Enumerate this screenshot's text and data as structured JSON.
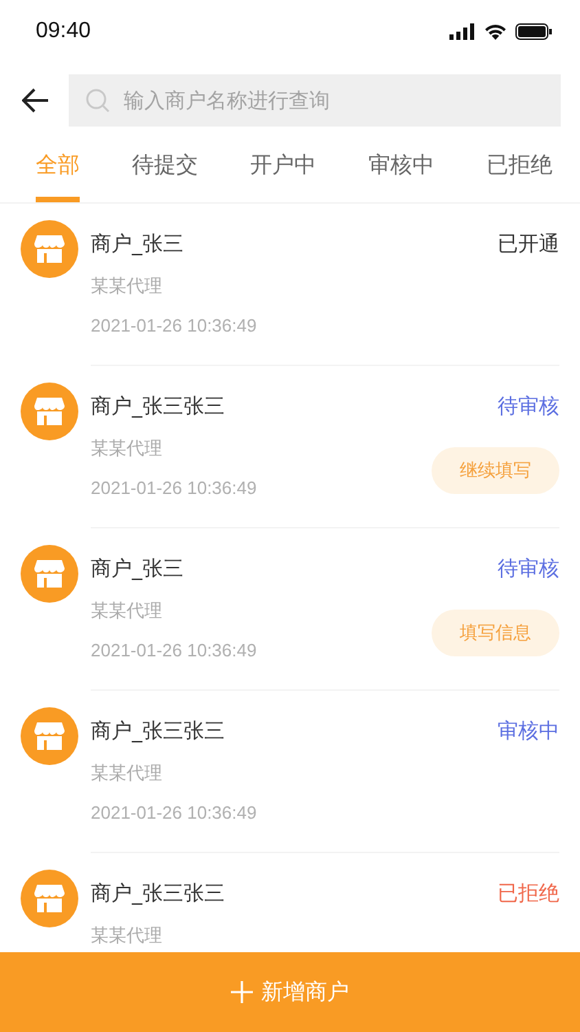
{
  "status_bar": {
    "time": "09:40"
  },
  "search": {
    "placeholder": "输入商户名称进行查询"
  },
  "tabs": [
    {
      "label": "全部",
      "selected": true
    },
    {
      "label": "待提交",
      "selected": false
    },
    {
      "label": "开户中",
      "selected": false
    },
    {
      "label": "审核中",
      "selected": false
    },
    {
      "label": "已拒绝",
      "selected": false
    }
  ],
  "merchants": [
    {
      "name": "商户_张三",
      "status": "已开通",
      "color": "#333333",
      "agent": "某某代理",
      "time": "2021-01-26  10:36:49"
    },
    {
      "name": "商户_张三张三",
      "status": "待审核",
      "color": "#5b6ee1",
      "agent": "某某代理",
      "time": "2021-01-26  10:36:49",
      "action": "继续填写"
    },
    {
      "name": "商户_张三",
      "status": "待审核",
      "color": "#5b6ee1",
      "agent": "某某代理",
      "time": "2021-01-26  10:36:49",
      "action": "填写信息"
    },
    {
      "name": "商户_张三张三",
      "status": "审核中",
      "color": "#5b6ee1",
      "agent": "某某代理",
      "time": "2021-01-26  10:36:49"
    },
    {
      "name": "商户_张三张三",
      "status": "已拒绝",
      "color": "#f0674a",
      "agent": "某某代理"
    }
  ],
  "add_button": {
    "label": "新增商户"
  }
}
